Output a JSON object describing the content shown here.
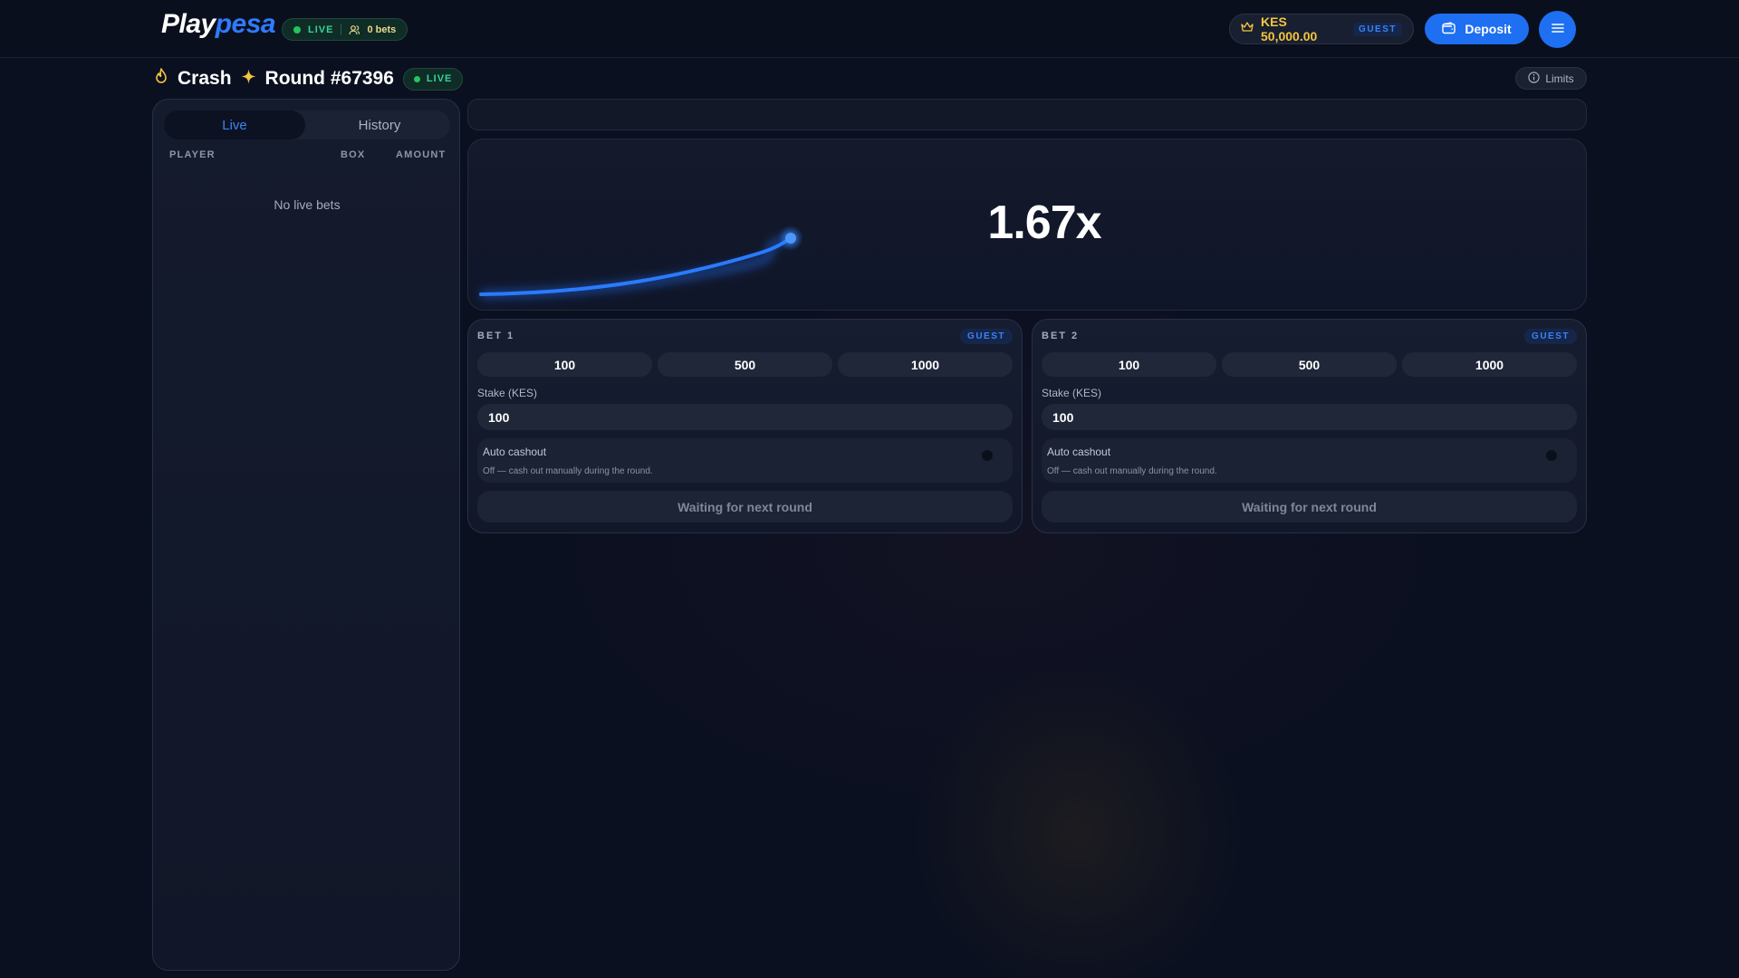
{
  "header": {
    "logo_play": "Play",
    "logo_pesa": "pesa",
    "live_label": "LIVE",
    "bets_count": "0 bets",
    "balance": "KES 50,000.00",
    "guest_tag": "GUEST",
    "deposit_label": "Deposit",
    "icons": {
      "user": "users-icon",
      "crown": "crown-icon",
      "wallet": "wallet-icon",
      "menu": "menu-icon"
    }
  },
  "title": {
    "game": "Crash",
    "round": "Round #67396",
    "live_label": "LIVE",
    "limits_label": "Limits",
    "icons": {
      "fire": "fire-icon",
      "sparkle": "sparkle-icon",
      "info": "info-icon"
    }
  },
  "left_panel": {
    "tabs": [
      {
        "label": "Live",
        "active": true
      },
      {
        "label": "History",
        "active": false
      }
    ],
    "columns": [
      "PLAYER",
      "BOX",
      "AMOUNT"
    ],
    "empty_text": "No live bets"
  },
  "graph": {
    "multiplier": "1.67x"
  },
  "bets": [
    {
      "title": "BET 1",
      "guest_tag": "GUEST",
      "chips": [
        "100",
        "500",
        "1000"
      ],
      "stake_label": "Stake (KES)",
      "stake_value": "100",
      "auto_cashout_title": "Auto cashout",
      "auto_cashout_desc": "Off — cash out manually during the round.",
      "auto_cashout_on": false,
      "action_label": "Waiting for next round"
    },
    {
      "title": "BET 2",
      "guest_tag": "GUEST",
      "chips": [
        "100",
        "500",
        "1000"
      ],
      "stake_label": "Stake (KES)",
      "stake_value": "100",
      "auto_cashout_title": "Auto cashout",
      "auto_cashout_desc": "Off — cash out manually during the round.",
      "auto_cashout_on": false,
      "action_label": "Waiting for next round"
    }
  ],
  "colors": {
    "background": "#0b1020",
    "accent_blue": "#1e6ff2",
    "live_green": "#22c55e",
    "balance_gold": "#f4c53d"
  }
}
